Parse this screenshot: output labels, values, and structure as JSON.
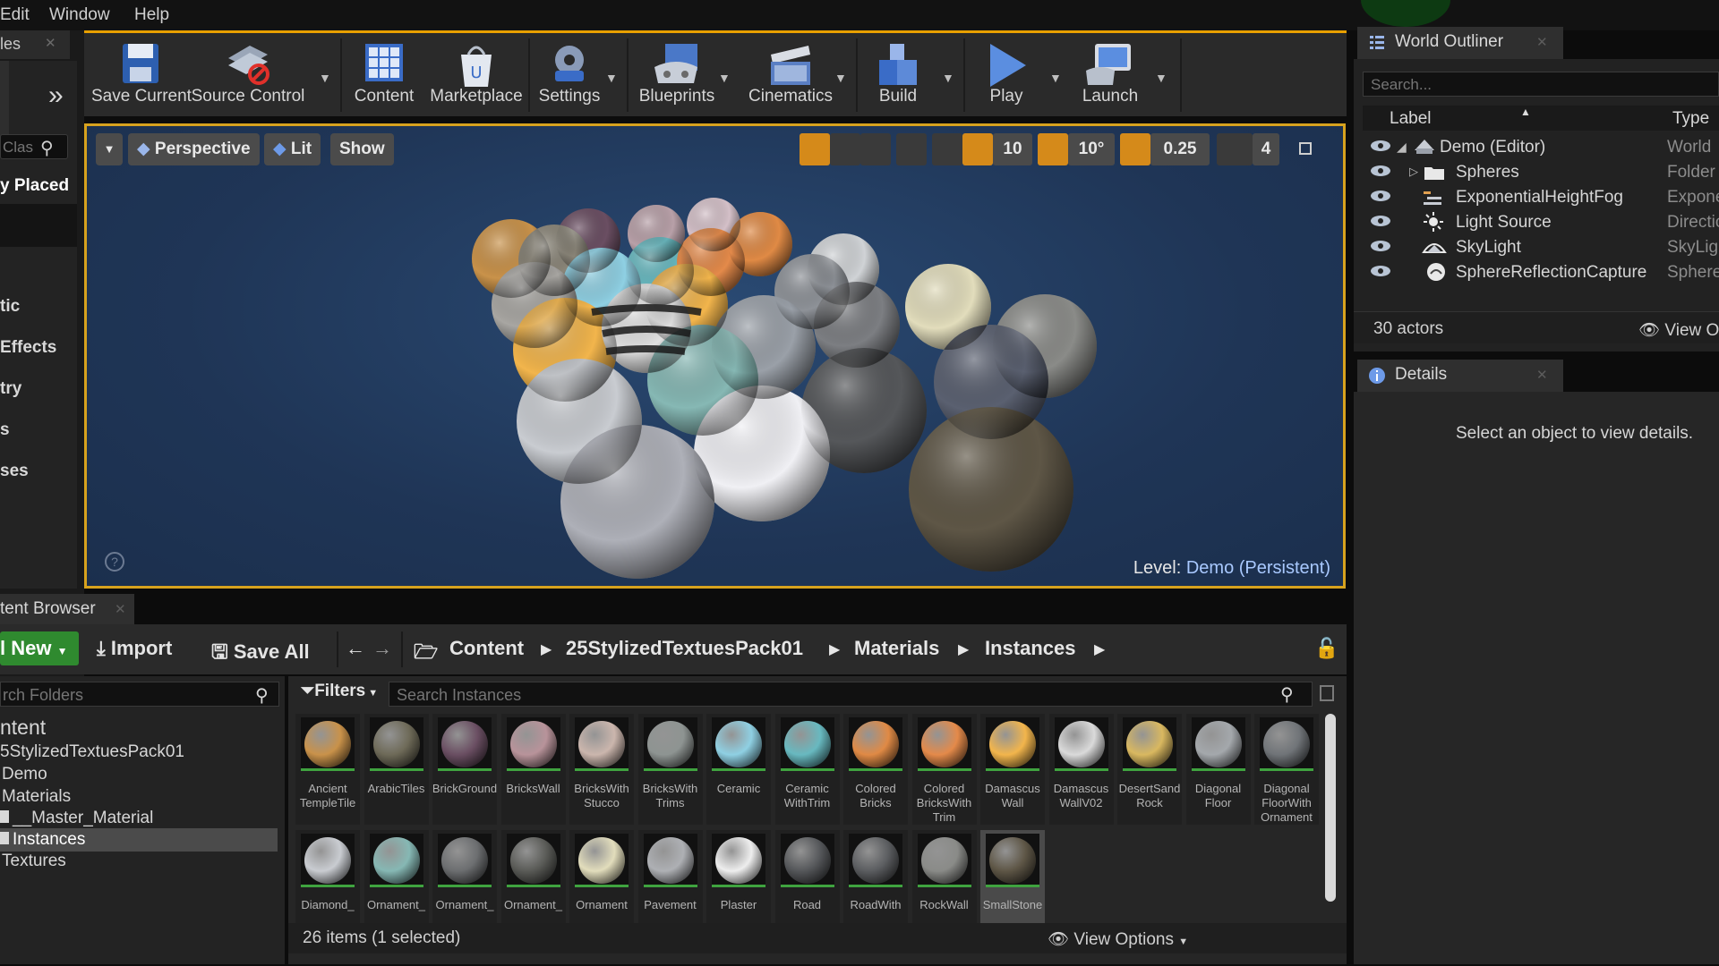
{
  "menu": [
    "Edit",
    "Window",
    "Help"
  ],
  "modes_panel": {
    "tab_label": "les",
    "search_placeholder": "Clas",
    "categories": [
      "y Placed",
      "tic",
      "Effects",
      "try",
      "s",
      "ses"
    ]
  },
  "toolbar": {
    "buttons": [
      {
        "label": "Save Current",
        "icon": "save-icon"
      },
      {
        "label": "Source Control",
        "icon": "source-control-icon"
      },
      {
        "label": "Content",
        "icon": "content-icon"
      },
      {
        "label": "Marketplace",
        "icon": "marketplace-icon"
      },
      {
        "label": "Settings",
        "icon": "settings-icon"
      },
      {
        "label": "Blueprints",
        "icon": "blueprints-icon"
      },
      {
        "label": "Cinematics",
        "icon": "cinematics-icon"
      },
      {
        "label": "Build",
        "icon": "build-icon"
      },
      {
        "label": "Play",
        "icon": "play-icon"
      },
      {
        "label": "Launch",
        "icon": "launch-icon"
      }
    ]
  },
  "viewport": {
    "perspective": "Perspective",
    "lit": "Lit",
    "show": "Show",
    "grid_snap": "10",
    "rotation_snap": "10°",
    "scale_snap": "0.25",
    "camera_speed": "4",
    "level_prefix": "Level:",
    "level_name": "Demo (Persistent)"
  },
  "outliner": {
    "tab": "World Outliner",
    "search_placeholder": "Search...",
    "col_label": "Label",
    "col_type": "Type",
    "rows": [
      {
        "name": "Demo (Editor)",
        "type": "World",
        "icon": "world-icon"
      },
      {
        "name": "Spheres",
        "type": "Folder",
        "icon": "folder-icon"
      },
      {
        "name": "ExponentialHeightFog",
        "type": "Expone",
        "icon": "fog-icon"
      },
      {
        "name": "Light Source",
        "type": "Directic",
        "icon": "light-icon"
      },
      {
        "name": "SkyLight",
        "type": "SkyLig",
        "icon": "skylight-icon"
      },
      {
        "name": "SphereReflectionCapture",
        "type": "Sphere",
        "icon": "reflection-icon"
      }
    ],
    "actors": "30 actors",
    "view_options": "View Op"
  },
  "details": {
    "tab": "Details",
    "message": "Select an object to view details."
  },
  "content_browser": {
    "tab": "tent Browser",
    "add_new": "l New",
    "import": "Import",
    "save_all": "Save All",
    "breadcrumbs": [
      "Content",
      "25StylizedTextuesPack01",
      "Materials",
      "Instances"
    ],
    "folder_search_placeholder": "rch Folders",
    "tree": [
      "ntent",
      "5StylizedTextuesPack01",
      "Demo",
      "Materials",
      "__Master_Material",
      "Instances",
      "Textures"
    ],
    "filters": "Filters",
    "asset_search_placeholder": "Search Instances",
    "assets": [
      {
        "name": "Ancient TempleTile",
        "color": "#c9924a"
      },
      {
        "name": "ArabicTiles",
        "color": "#6e6a58"
      },
      {
        "name": "BrickGround",
        "color": "#6a4e62"
      },
      {
        "name": "BricksWall",
        "color": "#b8939a"
      },
      {
        "name": "BricksWith Stucco",
        "color": "#cbb6ad"
      },
      {
        "name": "BricksWith Trims",
        "color": "#8e9492"
      },
      {
        "name": "Ceramic",
        "color": "#8fd0e3"
      },
      {
        "name": "Ceramic WithTrim",
        "color": "#68b9c0"
      },
      {
        "name": "Colored Bricks",
        "color": "#e08a45"
      },
      {
        "name": "Colored BricksWith Trim",
        "color": "#e48a4a"
      },
      {
        "name": "Damascus Wall",
        "color": "#f2b54c"
      },
      {
        "name": "Damascus WallV02",
        "color": "#dadada"
      },
      {
        "name": "DesertSand Rock",
        "color": "#d9b860"
      },
      {
        "name": "Diagonal Floor",
        "color": "#a4a8ac"
      },
      {
        "name": "Diagonal FloorWith Ornament",
        "color": "#707478"
      },
      {
        "name": "Diamond_",
        "color": "#c9ccd1"
      },
      {
        "name": "Ornament_",
        "color": "#86b8b4"
      },
      {
        "name": "Ornament_",
        "color": "#6c6e70"
      },
      {
        "name": "Ornament_",
        "color": "#5a5b57"
      },
      {
        "name": "Ornament",
        "color": "#e2ddbc"
      },
      {
        "name": "Pavement",
        "color": "#aeb0b4"
      },
      {
        "name": "Plaster",
        "color": "#eeeeee"
      },
      {
        "name": "Road",
        "color": "#55575a"
      },
      {
        "name": "RoadWith",
        "color": "#5b5d60"
      },
      {
        "name": "RockWall",
        "color": "#8a8b88"
      },
      {
        "name": "SmallStone",
        "color": "#5e5646"
      }
    ],
    "items": "26 items (1 selected)",
    "view_options": "View Options"
  }
}
